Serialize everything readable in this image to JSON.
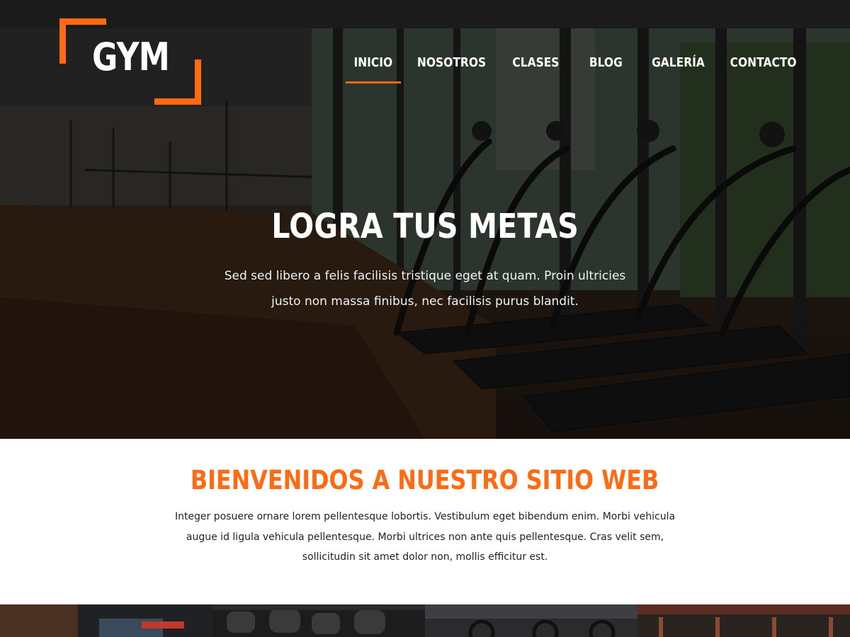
{
  "brand": {
    "logo_text": "GYM",
    "accent_color": "#ff6a13"
  },
  "nav": {
    "items": [
      {
        "label": "INICIO",
        "active": true
      },
      {
        "label": "NOSOTROS",
        "active": false
      },
      {
        "label": "CLASES",
        "active": false
      },
      {
        "label": "BLOG",
        "active": false
      },
      {
        "label": "GALERÍA",
        "active": false
      },
      {
        "label": "CONTACTO",
        "active": false
      }
    ]
  },
  "hero": {
    "title": "LOGRA TUS METAS",
    "subtitle": "Sed sed libero a felis facilisis tristique eget at quam. Proin ultricies justo non massa finibus, nec facilisis purus blandit.",
    "image": "gym-treadmills-photo"
  },
  "welcome": {
    "title": "BIENVENIDOS A NUESTRO SITIO WEB",
    "text": "Integer posuere ornare lorem pellentesque lobortis. Vestibulum eget bibendum enim. Morbi vehicula augue id ligula vehicula pellentesque. Morbi ultrices non ante quis pellentesque. Cras velit sem, sollicitudin sit amet dolor non, mollis efficitur est."
  },
  "gallery": {
    "items": [
      {
        "image": "gym-interior-photo"
      },
      {
        "image": "dumbbells-photo"
      },
      {
        "image": "spin-bikes-photo"
      },
      {
        "image": "gym-hall-photo"
      }
    ]
  }
}
